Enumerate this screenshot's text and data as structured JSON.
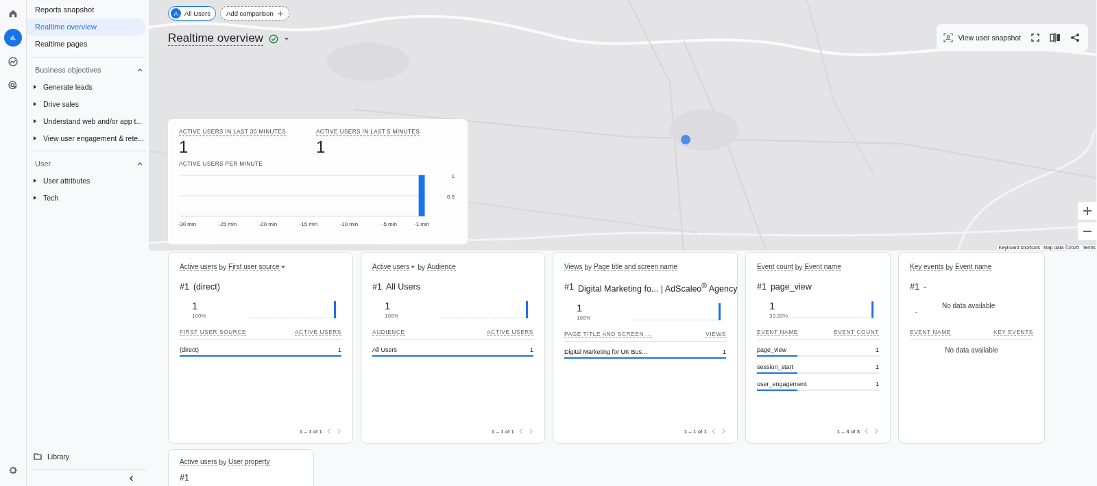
{
  "nav_rail": {
    "items": [
      {
        "kind": "home",
        "selected": false
      },
      {
        "kind": "reports",
        "selected": true
      },
      {
        "kind": "explore",
        "selected": false
      },
      {
        "kind": "advertising",
        "selected": false
      }
    ]
  },
  "sidebar": {
    "items": [
      {
        "label": "Reports snapshot",
        "selected": false
      },
      {
        "label": "Realtime overview",
        "selected": true
      },
      {
        "label": "Realtime pages",
        "selected": false
      }
    ],
    "sections": [
      {
        "title": "Business objectives",
        "expanded": true,
        "items": [
          {
            "label": "Generate leads",
            "expanded": false
          },
          {
            "label": "Drive sales",
            "expanded": false
          },
          {
            "label": "Understand web and/or app t...",
            "expanded": false
          },
          {
            "label": "View user engagement & rete...",
            "expanded": false
          }
        ]
      },
      {
        "title": "User",
        "expanded": true,
        "items": [
          {
            "label": "User attributes",
            "expanded": false
          },
          {
            "label": "Tech",
            "expanded": false
          }
        ]
      }
    ],
    "library": "Library"
  },
  "map": {
    "chips": [
      {
        "kind": "segment",
        "badge": "A",
        "label": "All Users"
      },
      {
        "kind": "add",
        "label": "Add comparison"
      }
    ],
    "title": "Realtime overview",
    "verified": true,
    "snapshot_button": "View user snapshot",
    "attribution": [
      "Keyboard shortcuts",
      "Map data ©2025",
      "Terms"
    ]
  },
  "realtime": {
    "stats": [
      {
        "label": "ACTIVE USERS IN LAST 30 MINUTES",
        "value": "1"
      },
      {
        "label": "ACTIVE USERS IN LAST 5 MINUTES",
        "value": "1"
      }
    ],
    "chart_title": "ACTIVE USERS PER MINUTE",
    "chart_data": {
      "type": "bar",
      "x": [
        -1
      ],
      "values": [
        1
      ],
      "xlim": [
        -30.5,
        -0.5
      ],
      "ylim": [
        0,
        1
      ],
      "xticks": [
        {
          "value": -30,
          "label": "-30 min"
        },
        {
          "value": -25,
          "label": "-25 min"
        },
        {
          "value": -20,
          "label": "-20 min"
        },
        {
          "value": -15,
          "label": "-15 min"
        },
        {
          "value": -10,
          "label": "-10 min"
        },
        {
          "value": -5,
          "label": "-5 min"
        },
        {
          "value": -1,
          "label": "-1 min"
        }
      ],
      "yticks": [
        {
          "value": 0.5,
          "label": "0.5"
        },
        {
          "value": 1,
          "label": "1"
        }
      ]
    }
  },
  "cards": [
    {
      "kind": "table",
      "title": {
        "metric": "Active users",
        "connector": "by",
        "dimension": "First user source",
        "metric_dropdown": false,
        "dimension_dropdown": true
      },
      "headline": {
        "rank": "#1",
        "name": "(direct)"
      },
      "value": "1",
      "share": "100%",
      "columns": [
        "FIRST USER SOURCE",
        "ACTIVE USERS"
      ],
      "rows": [
        {
          "label": "(direct)",
          "value": "1",
          "level": 1
        }
      ],
      "pagination": "1 – 1 of 1"
    },
    {
      "kind": "table",
      "title": {
        "metric": "Active users",
        "connector": "by",
        "dimension": "Audience",
        "metric_dropdown": true,
        "dimension_dropdown": false
      },
      "headline": {
        "rank": "#1",
        "name": "All Users"
      },
      "value": "1",
      "share": "100%",
      "columns": [
        "AUDIENCE",
        "ACTIVE USERS"
      ],
      "rows": [
        {
          "label": "All Users",
          "value": "1",
          "level": 1
        }
      ],
      "pagination": "1 – 1 of 1"
    },
    {
      "kind": "table",
      "title": {
        "metric": "Views",
        "connector": "by",
        "dimension": "Page title and screen name",
        "metric_dropdown": false,
        "dimension_dropdown": false
      },
      "headline": {
        "rank": "#1",
        "name": "Digital Marketing fo... | AdScaleo$^{®}$ Agency"
      },
      "value": "1",
      "share": "100%",
      "columns": [
        "PAGE TITLE AND SCREEN ...",
        "VIEWS"
      ],
      "rows": [
        {
          "label": "Digital Marketing for UK Bus...",
          "value": "1",
          "level": 1
        }
      ],
      "pagination": "1 – 1 of 1"
    },
    {
      "kind": "table",
      "title": {
        "metric": "Event count",
        "connector": "by",
        "dimension": "Event name",
        "metric_dropdown": false,
        "dimension_dropdown": false
      },
      "headline": {
        "rank": "#1",
        "name": "page_view"
      },
      "value": "1",
      "share": "33.33%",
      "columns": [
        "EVENT NAME",
        "EVENT COUNT"
      ],
      "rows": [
        {
          "label": "page_view",
          "value": "1",
          "level": 0.3333
        },
        {
          "label": "session_start",
          "value": "1",
          "level": 0.3333
        },
        {
          "label": "user_engagement",
          "value": "1",
          "level": 0.3333
        }
      ],
      "pagination": "1 – 3 of 3"
    },
    {
      "kind": "empty",
      "title": {
        "metric": "Key events",
        "connector": "by",
        "dimension": "Event name",
        "metric_dropdown": false,
        "dimension_dropdown": false
      },
      "headline": {
        "rank": "#1",
        "name": "-"
      },
      "value": "-",
      "message": "No data available",
      "columns": [
        "EVENT NAME",
        "KEY EVENTS"
      ],
      "table_message": "No data available"
    }
  ],
  "more_cards": [
    {
      "title": {
        "metric": "Active users",
        "connector": "by",
        "dimension": "User property"
      },
      "headline": {
        "rank": "#1"
      }
    }
  ]
}
